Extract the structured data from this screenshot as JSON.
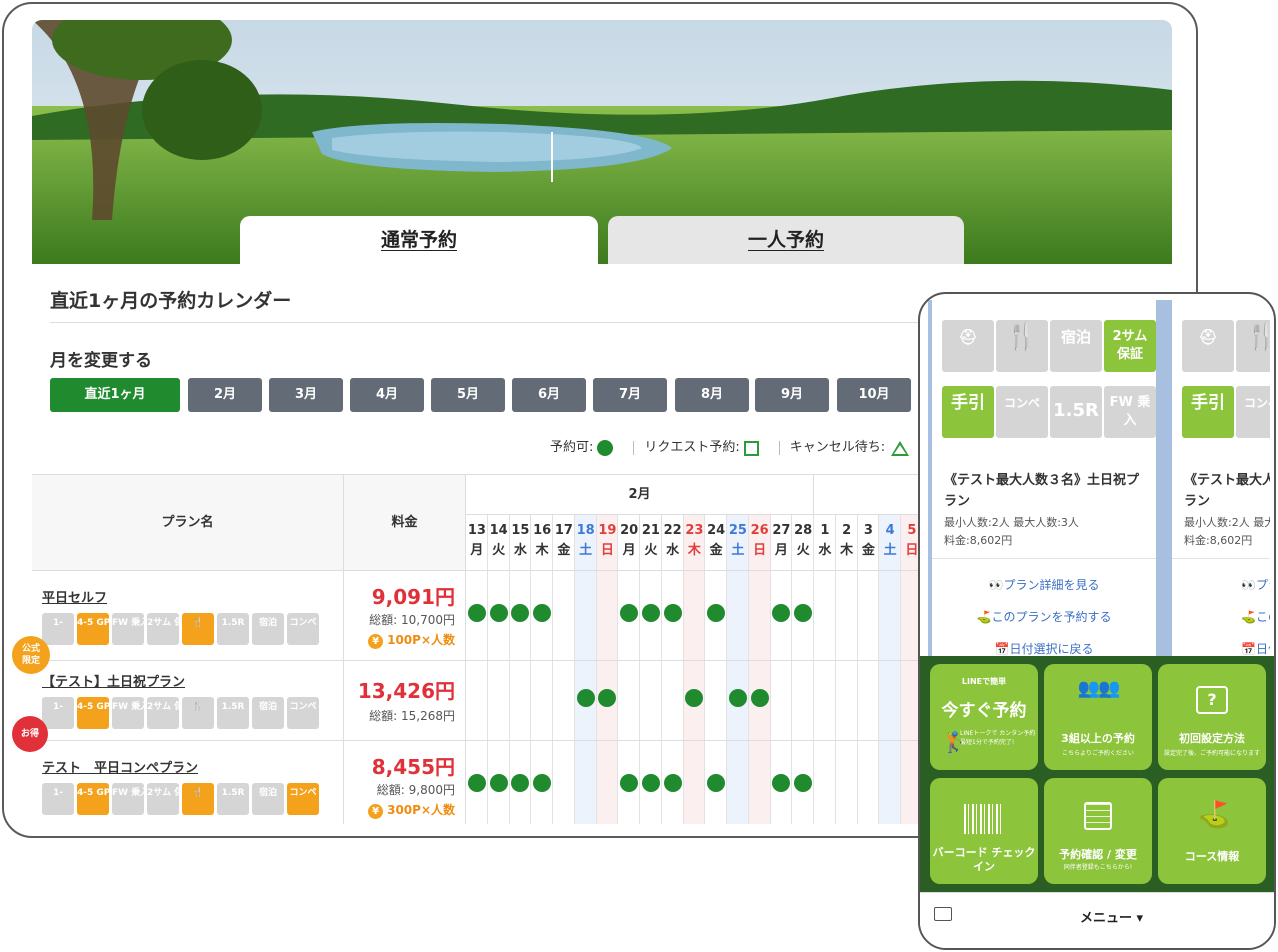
{
  "tabs": {
    "normal": "通常予約",
    "solo": "一人予約"
  },
  "calendar": {
    "title": "直近1ヶ月の予約カレンダー",
    "month_change_label": "月を変更する",
    "months": [
      "直近1ヶ月",
      "2月",
      "3月",
      "4月",
      "5月",
      "6月",
      "7月",
      "8月",
      "9月",
      "10月"
    ],
    "legend": {
      "available": "予約可:",
      "request": "リクエスト予約:",
      "cancel_wait": "キャンセル待ち:"
    },
    "colors": {
      "accent": "#1f8a2e",
      "price": "#e0303a",
      "points": "#f08c10",
      "icon_on": "#f4a11b",
      "sat": "#3f7ad8",
      "sun": "#e0403a"
    }
  },
  "table": {
    "header_plan": "プラン名",
    "header_price": "料金",
    "month_header": "2月",
    "days": [
      {
        "d": "13",
        "w": "月",
        "t": ""
      },
      {
        "d": "14",
        "w": "火",
        "t": ""
      },
      {
        "d": "15",
        "w": "水",
        "t": ""
      },
      {
        "d": "16",
        "w": "木",
        "t": ""
      },
      {
        "d": "17",
        "w": "金",
        "t": ""
      },
      {
        "d": "18",
        "w": "土",
        "t": "sat"
      },
      {
        "d": "19",
        "w": "日",
        "t": "sun"
      },
      {
        "d": "20",
        "w": "月",
        "t": ""
      },
      {
        "d": "21",
        "w": "火",
        "t": ""
      },
      {
        "d": "22",
        "w": "水",
        "t": ""
      },
      {
        "d": "23",
        "w": "木",
        "t": "sun"
      },
      {
        "d": "24",
        "w": "金",
        "t": ""
      },
      {
        "d": "25",
        "w": "土",
        "t": "sat"
      },
      {
        "d": "26",
        "w": "日",
        "t": "sun"
      },
      {
        "d": "27",
        "w": "月",
        "t": ""
      },
      {
        "d": "28",
        "w": "火",
        "t": ""
      },
      {
        "d": "1",
        "w": "水",
        "t": ""
      },
      {
        "d": "2",
        "w": "木",
        "t": ""
      },
      {
        "d": "3",
        "w": "金",
        "t": ""
      },
      {
        "d": "4",
        "w": "土",
        "t": "sat"
      },
      {
        "d": "5",
        "w": "日",
        "t": "sun"
      }
    ],
    "plans": [
      {
        "name": "平日セルフ",
        "price": "9,091円",
        "total": "総額: 10,700円",
        "points": "100P×人数",
        "badge": "公式限定",
        "icons": [
          {
            "label": "1-",
            "on": false
          },
          {
            "label": "4-5 GPS",
            "on": true
          },
          {
            "label": "FW 乗入",
            "on": false
          },
          {
            "label": "2サム 保証",
            "on": false
          },
          {
            "label": "🍴",
            "on": true
          },
          {
            "label": "1.5R",
            "on": false
          },
          {
            "label": "宿泊",
            "on": false
          },
          {
            "label": "コンペ",
            "on": false
          }
        ],
        "available": [
          0,
          1,
          2,
          3,
          7,
          8,
          9,
          11,
          14,
          15
        ]
      },
      {
        "name": "【テスト】土日祝プラン",
        "price": "13,426円",
        "total": "総額: 15,268円",
        "points": "",
        "badge": "お得",
        "icons": [
          {
            "label": "1-",
            "on": false
          },
          {
            "label": "4-5 GPS",
            "on": true
          },
          {
            "label": "FW 乗入",
            "on": false
          },
          {
            "label": "2サム 保証",
            "on": false
          },
          {
            "label": "🍴",
            "on": false
          },
          {
            "label": "1.5R",
            "on": false
          },
          {
            "label": "宿泊",
            "on": false
          },
          {
            "label": "コンペ",
            "on": false
          }
        ],
        "available": [
          5,
          6,
          10,
          12,
          13
        ]
      },
      {
        "name": "テスト　平日コンペプラン",
        "price": "8,455円",
        "total": "総額: 9,800円",
        "points": "300P×人数",
        "badge": "",
        "icons": [
          {
            "label": "1-",
            "on": false
          },
          {
            "label": "4-5 GPS",
            "on": true
          },
          {
            "label": "FW 乗入",
            "on": false
          },
          {
            "label": "2サム 保証",
            "on": false
          },
          {
            "label": "🍴",
            "on": true
          },
          {
            "label": "1.5R",
            "on": false
          },
          {
            "label": "宿泊",
            "on": false
          },
          {
            "label": "コンペ",
            "on": true
          }
        ],
        "available": [
          0,
          1,
          2,
          3,
          7,
          8,
          9,
          11,
          14,
          15
        ]
      }
    ]
  },
  "phone": {
    "card": {
      "title": "《テスト最大人数３名》土日祝プラン",
      "title2": "《テスト最大人",
      "min_max": "最小人数:2人 最大人数:3人",
      "min_max2": "最小人数:2人 最大",
      "price": "料金:8,602円",
      "link_detail": "👀プラン詳細を見る",
      "link_reserve": "⛳このプランを予約する",
      "link_back": "📅日付選択に戻る",
      "link_reserve2": "⛳この",
      "link_back2": "📅日付",
      "link_detail2": "👀プラ",
      "title2_line2": "ラン",
      "icon_labels": [
        "宿泊",
        "2サム 保証",
        "手引",
        "コンペ",
        "1.5R",
        "FW 乗入"
      ]
    },
    "menu": {
      "quick_top": "LINEで簡単",
      "quick_title": "今すぐ予約",
      "quick_sub": "LINEトークで カンタン予約 最短1分で予約完了!",
      "group_title": "3組以上の予約",
      "group_sub": "こちらよりご予約ください",
      "setup_title": "初回設定方法",
      "setup_sub": "設定完了後、ご予約可能になります",
      "barcode_title": "バーコード チェックイン",
      "confirm_title": "予約確認 / 変更",
      "confirm_sub": "同伴者登録もこちらから!",
      "course_title": "コース情報",
      "bar_label": "メニュー ▾"
    }
  }
}
